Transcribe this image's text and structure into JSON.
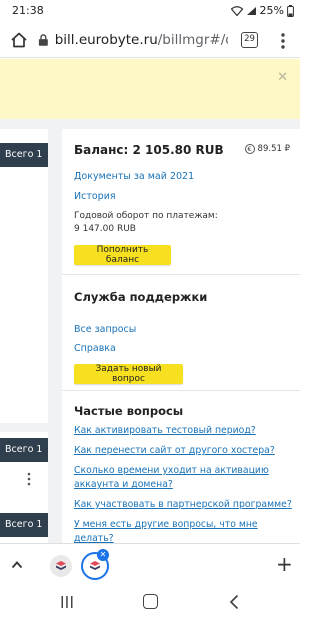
{
  "status_bar": {
    "time": "21:38",
    "battery": "25%",
    "icons": [
      "wifi-icon",
      "signal-icon",
      "battery-icon"
    ]
  },
  "browser": {
    "url_host": "bill.eurobyte.ru",
    "url_path": "/billmgr#/das",
    "tab_count": "29"
  },
  "sidebar": {
    "badges": [
      "Всего 1",
      "Всего 1",
      "Всего 1"
    ]
  },
  "balance": {
    "title": "Баланс: 2 105.80 RUB",
    "side_value": "89.51 ₽",
    "docs_link": "Документы за май 2021",
    "history_link": "История",
    "turnover_label": "Годовой оборот по платежам:",
    "turnover_value": "9 147.00 RUB",
    "topup_button": "Пополнить баланс"
  },
  "support": {
    "title": "Служба поддержки",
    "all_requests_link": "Все запросы",
    "help_link": "Справка",
    "new_request_button": "Задать новый вопрос"
  },
  "faq": {
    "title": "Частые вопросы",
    "items": [
      "Как активировать тестовый период?",
      "Как перенести сайт от другого хостера?",
      "Сколько времени уходит на активацию аккаунта и домена?",
      "Как участвовать в партнерской программе?",
      "У меня есть другие вопросы, что мне делать?"
    ]
  },
  "colors": {
    "accent_yellow": "#f6e020",
    "banner": "#fdf8c5",
    "badge": "#2f3f4d",
    "link": "#1a73b8",
    "tab_active": "#1a73e8"
  }
}
